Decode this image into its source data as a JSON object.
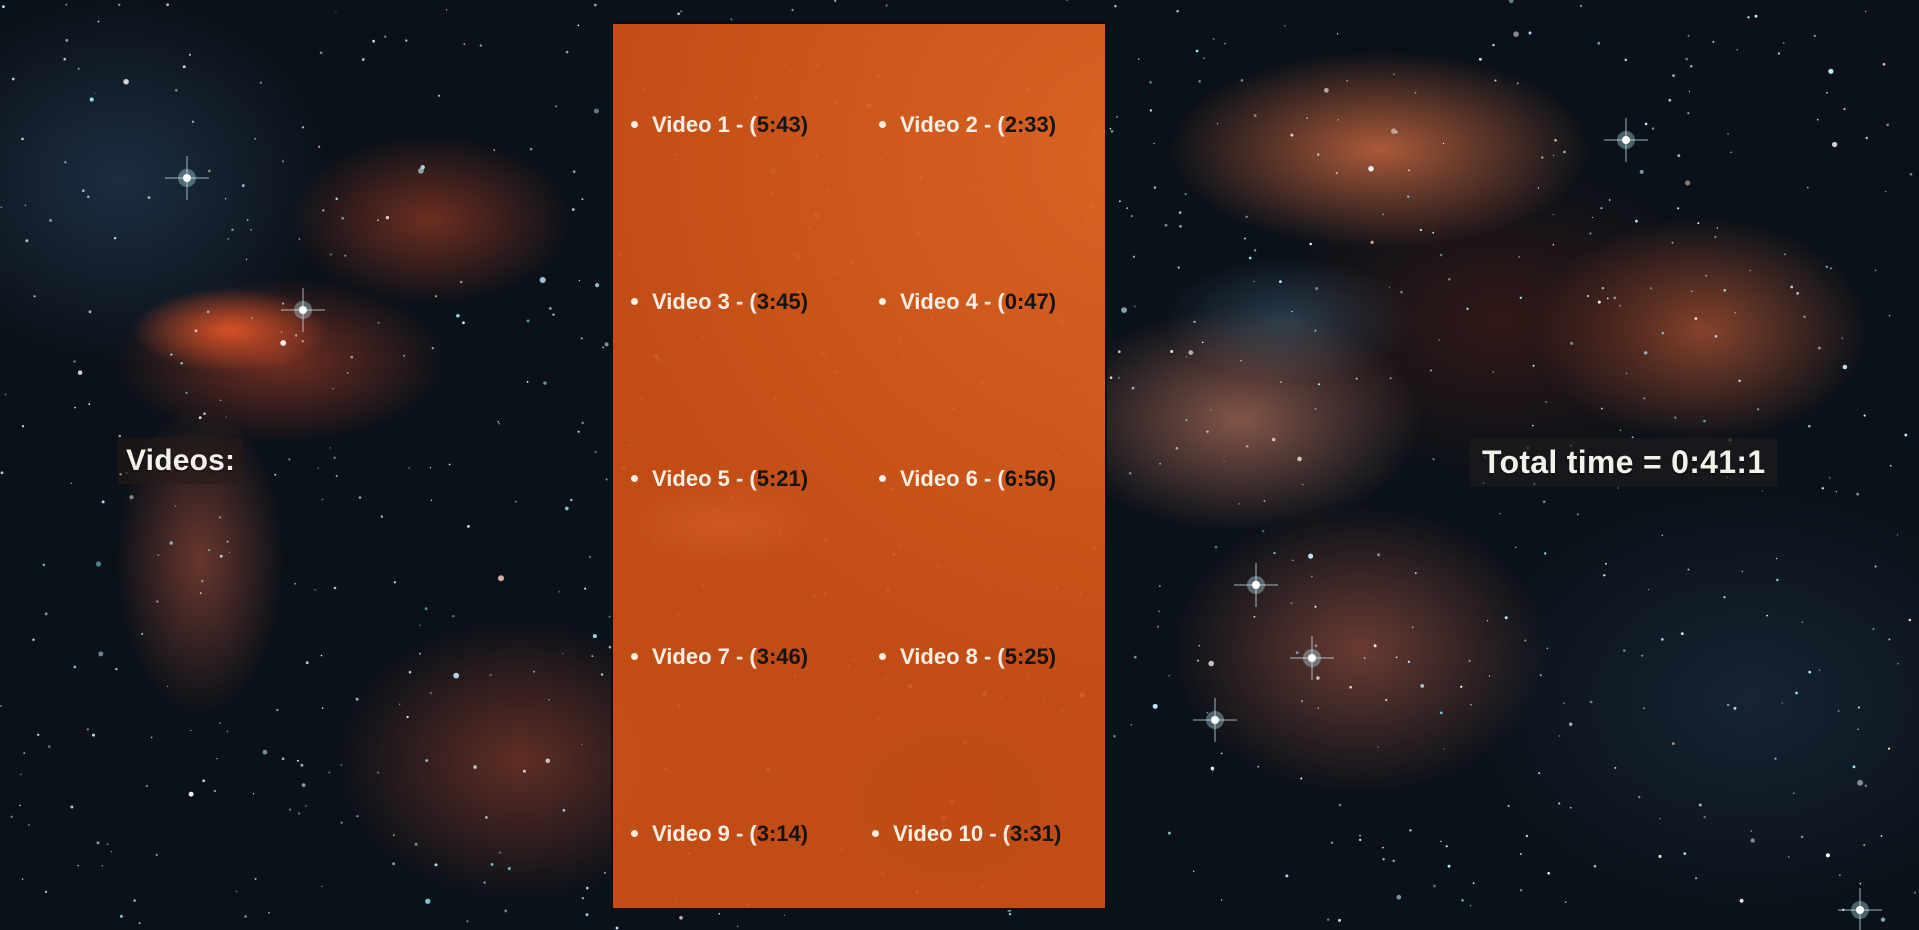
{
  "background": {
    "description_icon": "nebula-starfield-background"
  },
  "sidebar_label": "Videos:",
  "videos": [
    {
      "title": "Video 1",
      "duration": "5:43"
    },
    {
      "title": "Video 2",
      "duration": "2:33"
    },
    {
      "title": "Video 3",
      "duration": "3:45"
    },
    {
      "title": "Video 4",
      "duration": "0:47"
    },
    {
      "title": "Video 5",
      "duration": "5:21"
    },
    {
      "title": "Video 6",
      "duration": "6:56"
    },
    {
      "title": "Video 7",
      "duration": "3:46"
    },
    {
      "title": "Video 8",
      "duration": "5:25"
    },
    {
      "title": "Video 9",
      "duration": "3:14"
    },
    {
      "title": "Video 10",
      "duration": "3:31"
    }
  ],
  "total_time": "Total time = 0:41:1",
  "colors": {
    "panel": "#d05216",
    "text_light": "#fbeee4",
    "duration_text": "#141414"
  }
}
